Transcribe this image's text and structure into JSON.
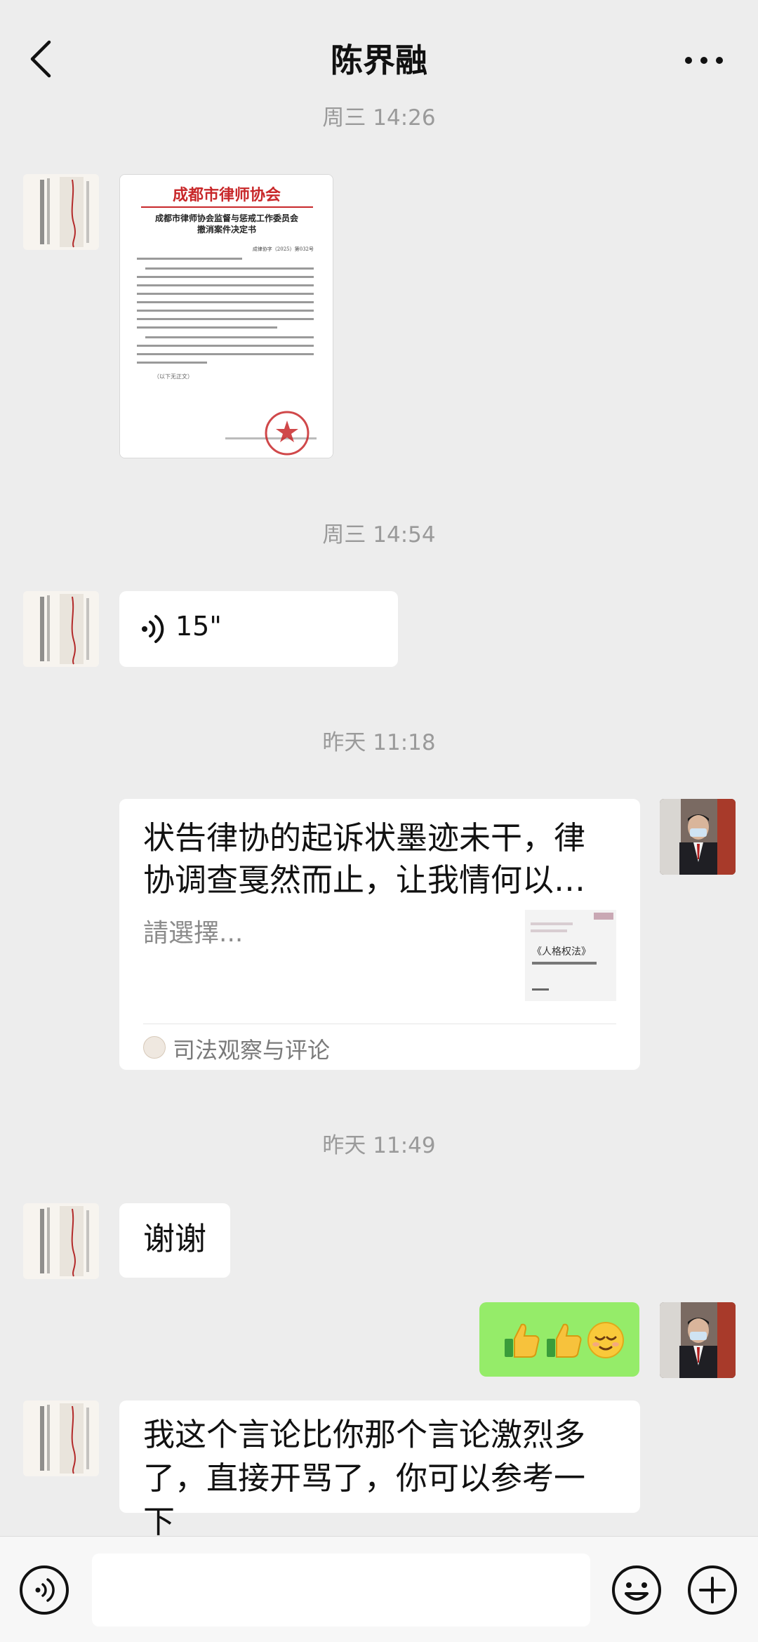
{
  "header": {
    "title": "陈界融",
    "back_icon": "chevron-left-icon",
    "more_icon": "more-dots-icon"
  },
  "messages": [
    {
      "type": "timestamp",
      "text": "周三 14:26"
    },
    {
      "type": "image",
      "side": "left",
      "doc": {
        "org": "成都市律师协会",
        "heading1": "成都市律师协会监督与惩戒工作委员会",
        "heading2": "撤消案件决定书",
        "ref": "成律协字（2025）第032号",
        "footer": "（以下无正文）"
      }
    },
    {
      "type": "timestamp",
      "text": "周三 14:54"
    },
    {
      "type": "voice",
      "side": "left",
      "duration": "15\""
    },
    {
      "type": "timestamp",
      "text": "昨天 11:18"
    },
    {
      "type": "link",
      "side": "right",
      "title_line1": "状告律协的起诉状墨迹未干，律",
      "title_line2": "协调查戛然而止，让我情何以…",
      "desc": "請選擇...",
      "thumb_text": "《人格权法》",
      "source": "司法观察与评论"
    },
    {
      "type": "timestamp",
      "text": "昨天 11:49"
    },
    {
      "type": "text",
      "side": "left",
      "text": "谢谢"
    },
    {
      "type": "emoji",
      "side": "right",
      "emojis": [
        "thumbs-up-icon",
        "thumbs-up-icon",
        "smiling-face-icon"
      ]
    },
    {
      "type": "text",
      "side": "left",
      "line1": "我这个言论比你那个言论激烈多",
      "line2": "了，直接开骂了，你可以参考一下"
    }
  ],
  "colors": {
    "background": "#ededed",
    "bubble_self": "#95ec69",
    "bubble_other": "#ffffff",
    "timestamp": "#9a9a9a",
    "stamp_red": "#c8282a"
  },
  "input_bar": {
    "voice_icon": "voice-input-icon",
    "emoji_icon": "emoji-icon",
    "plus_icon": "plus-circle-icon"
  }
}
